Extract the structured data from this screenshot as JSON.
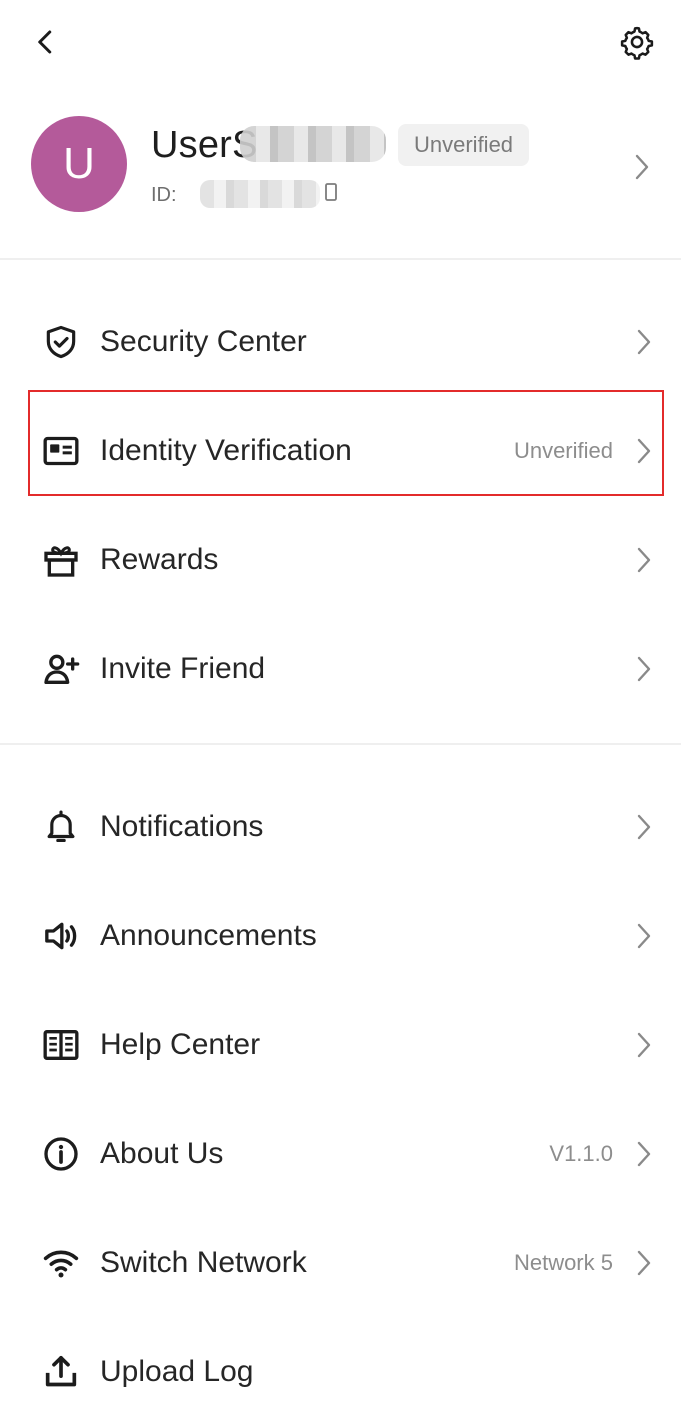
{
  "topbar": {
    "back_icon": "back-arrow-icon",
    "settings_icon": "gear-icon"
  },
  "profile": {
    "avatar_initial": "U",
    "username_prefix": "UserS",
    "status_badge": "Unverified",
    "id_label": "ID:",
    "copy_icon": "copy-icon"
  },
  "menu": {
    "group1": [
      {
        "label": "Security Center",
        "icon": "shield-check-icon"
      },
      {
        "label": "Identity Verification",
        "value": "Unverified",
        "icon": "id-card-icon"
      },
      {
        "label": "Rewards",
        "icon": "gift-icon"
      },
      {
        "label": "Invite Friend",
        "icon": "add-user-icon"
      }
    ],
    "group2": [
      {
        "label": "Notifications",
        "icon": "bell-icon"
      },
      {
        "label": "Announcements",
        "icon": "speaker-icon"
      },
      {
        "label": "Help Center",
        "icon": "book-icon"
      },
      {
        "label": "About Us",
        "value": "V1.1.0",
        "icon": "info-icon"
      },
      {
        "label": "Switch Network",
        "value": "Network 5",
        "icon": "wifi-icon"
      },
      {
        "label": "Upload Log",
        "icon": "upload-icon"
      }
    ]
  },
  "colors": {
    "avatar": "#b45a9a",
    "highlight_border": "#e32b2b"
  }
}
